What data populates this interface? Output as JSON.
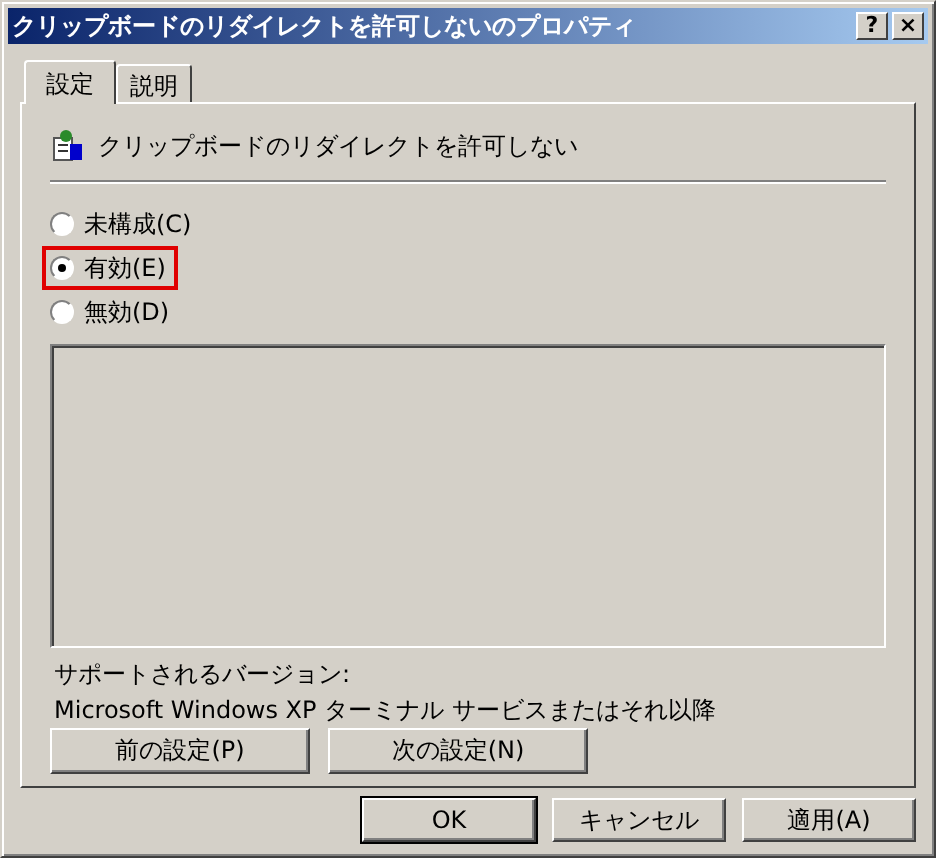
{
  "window": {
    "title": "クリップボードのリダイレクトを許可しないのプロパティ",
    "help_button": "?",
    "close_button": "×"
  },
  "tabs": [
    {
      "label": "設定",
      "selected": true
    },
    {
      "label": "説明",
      "selected": false
    }
  ],
  "policy": {
    "name": "クリップボードのリダイレクトを許可しない"
  },
  "options": [
    {
      "label": "未構成(C)",
      "selected": false,
      "highlighted": false
    },
    {
      "label": "有効(E)",
      "selected": true,
      "highlighted": true
    },
    {
      "label": "無効(D)",
      "selected": false,
      "highlighted": false
    }
  ],
  "supported_label": "サポートされるバージョン:",
  "supported_value": "Microsoft Windows XP ターミナル サービスまたはそれ以降",
  "nav_buttons": [
    "前の設定(P)",
    "次の設定(N)"
  ],
  "buttons": [
    {
      "label": "OK",
      "default": true
    },
    {
      "label": "キャンセル",
      "default": false
    },
    {
      "label": "適用(A)",
      "default": false
    }
  ]
}
